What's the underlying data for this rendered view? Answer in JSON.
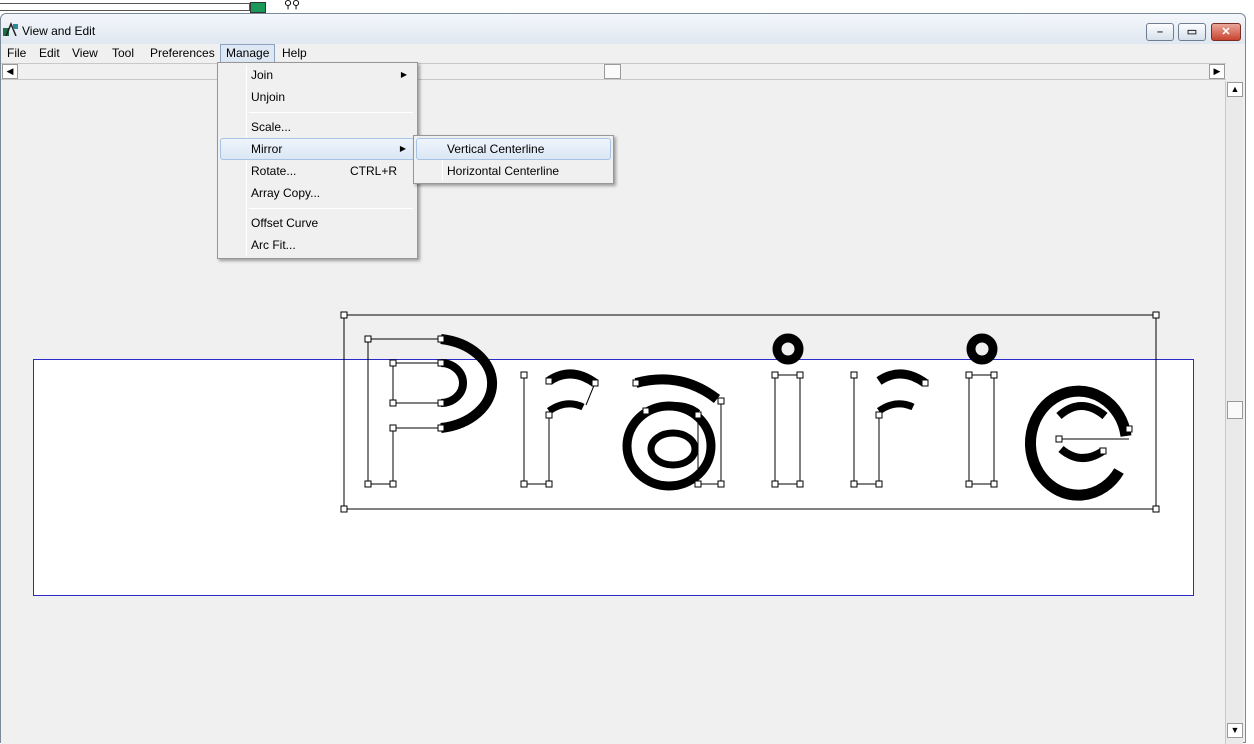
{
  "window": {
    "title": "View and Edit"
  },
  "menubar": [
    "File",
    "Edit",
    "View",
    "Tool",
    "Preferences",
    "Manage",
    "Help"
  ],
  "manage_menu": {
    "join": "Join",
    "unjoin": "Unjoin",
    "scale": "Scale...",
    "mirror": "Mirror",
    "rotate": "Rotate...",
    "rotate_shortcut": "CTRL+R",
    "array_copy": "Array Copy...",
    "offset_curve": "Offset Curve",
    "arc_fit": "Arc Fit..."
  },
  "mirror_submenu": {
    "vertical": "Vertical Centerline",
    "horizontal": "Horizontal Centerline"
  },
  "design": {
    "text": "Prairie"
  },
  "colors": {
    "frame": "#2b2bc8",
    "highlight": "#dbe7f5",
    "close_button": "#c8442f"
  }
}
